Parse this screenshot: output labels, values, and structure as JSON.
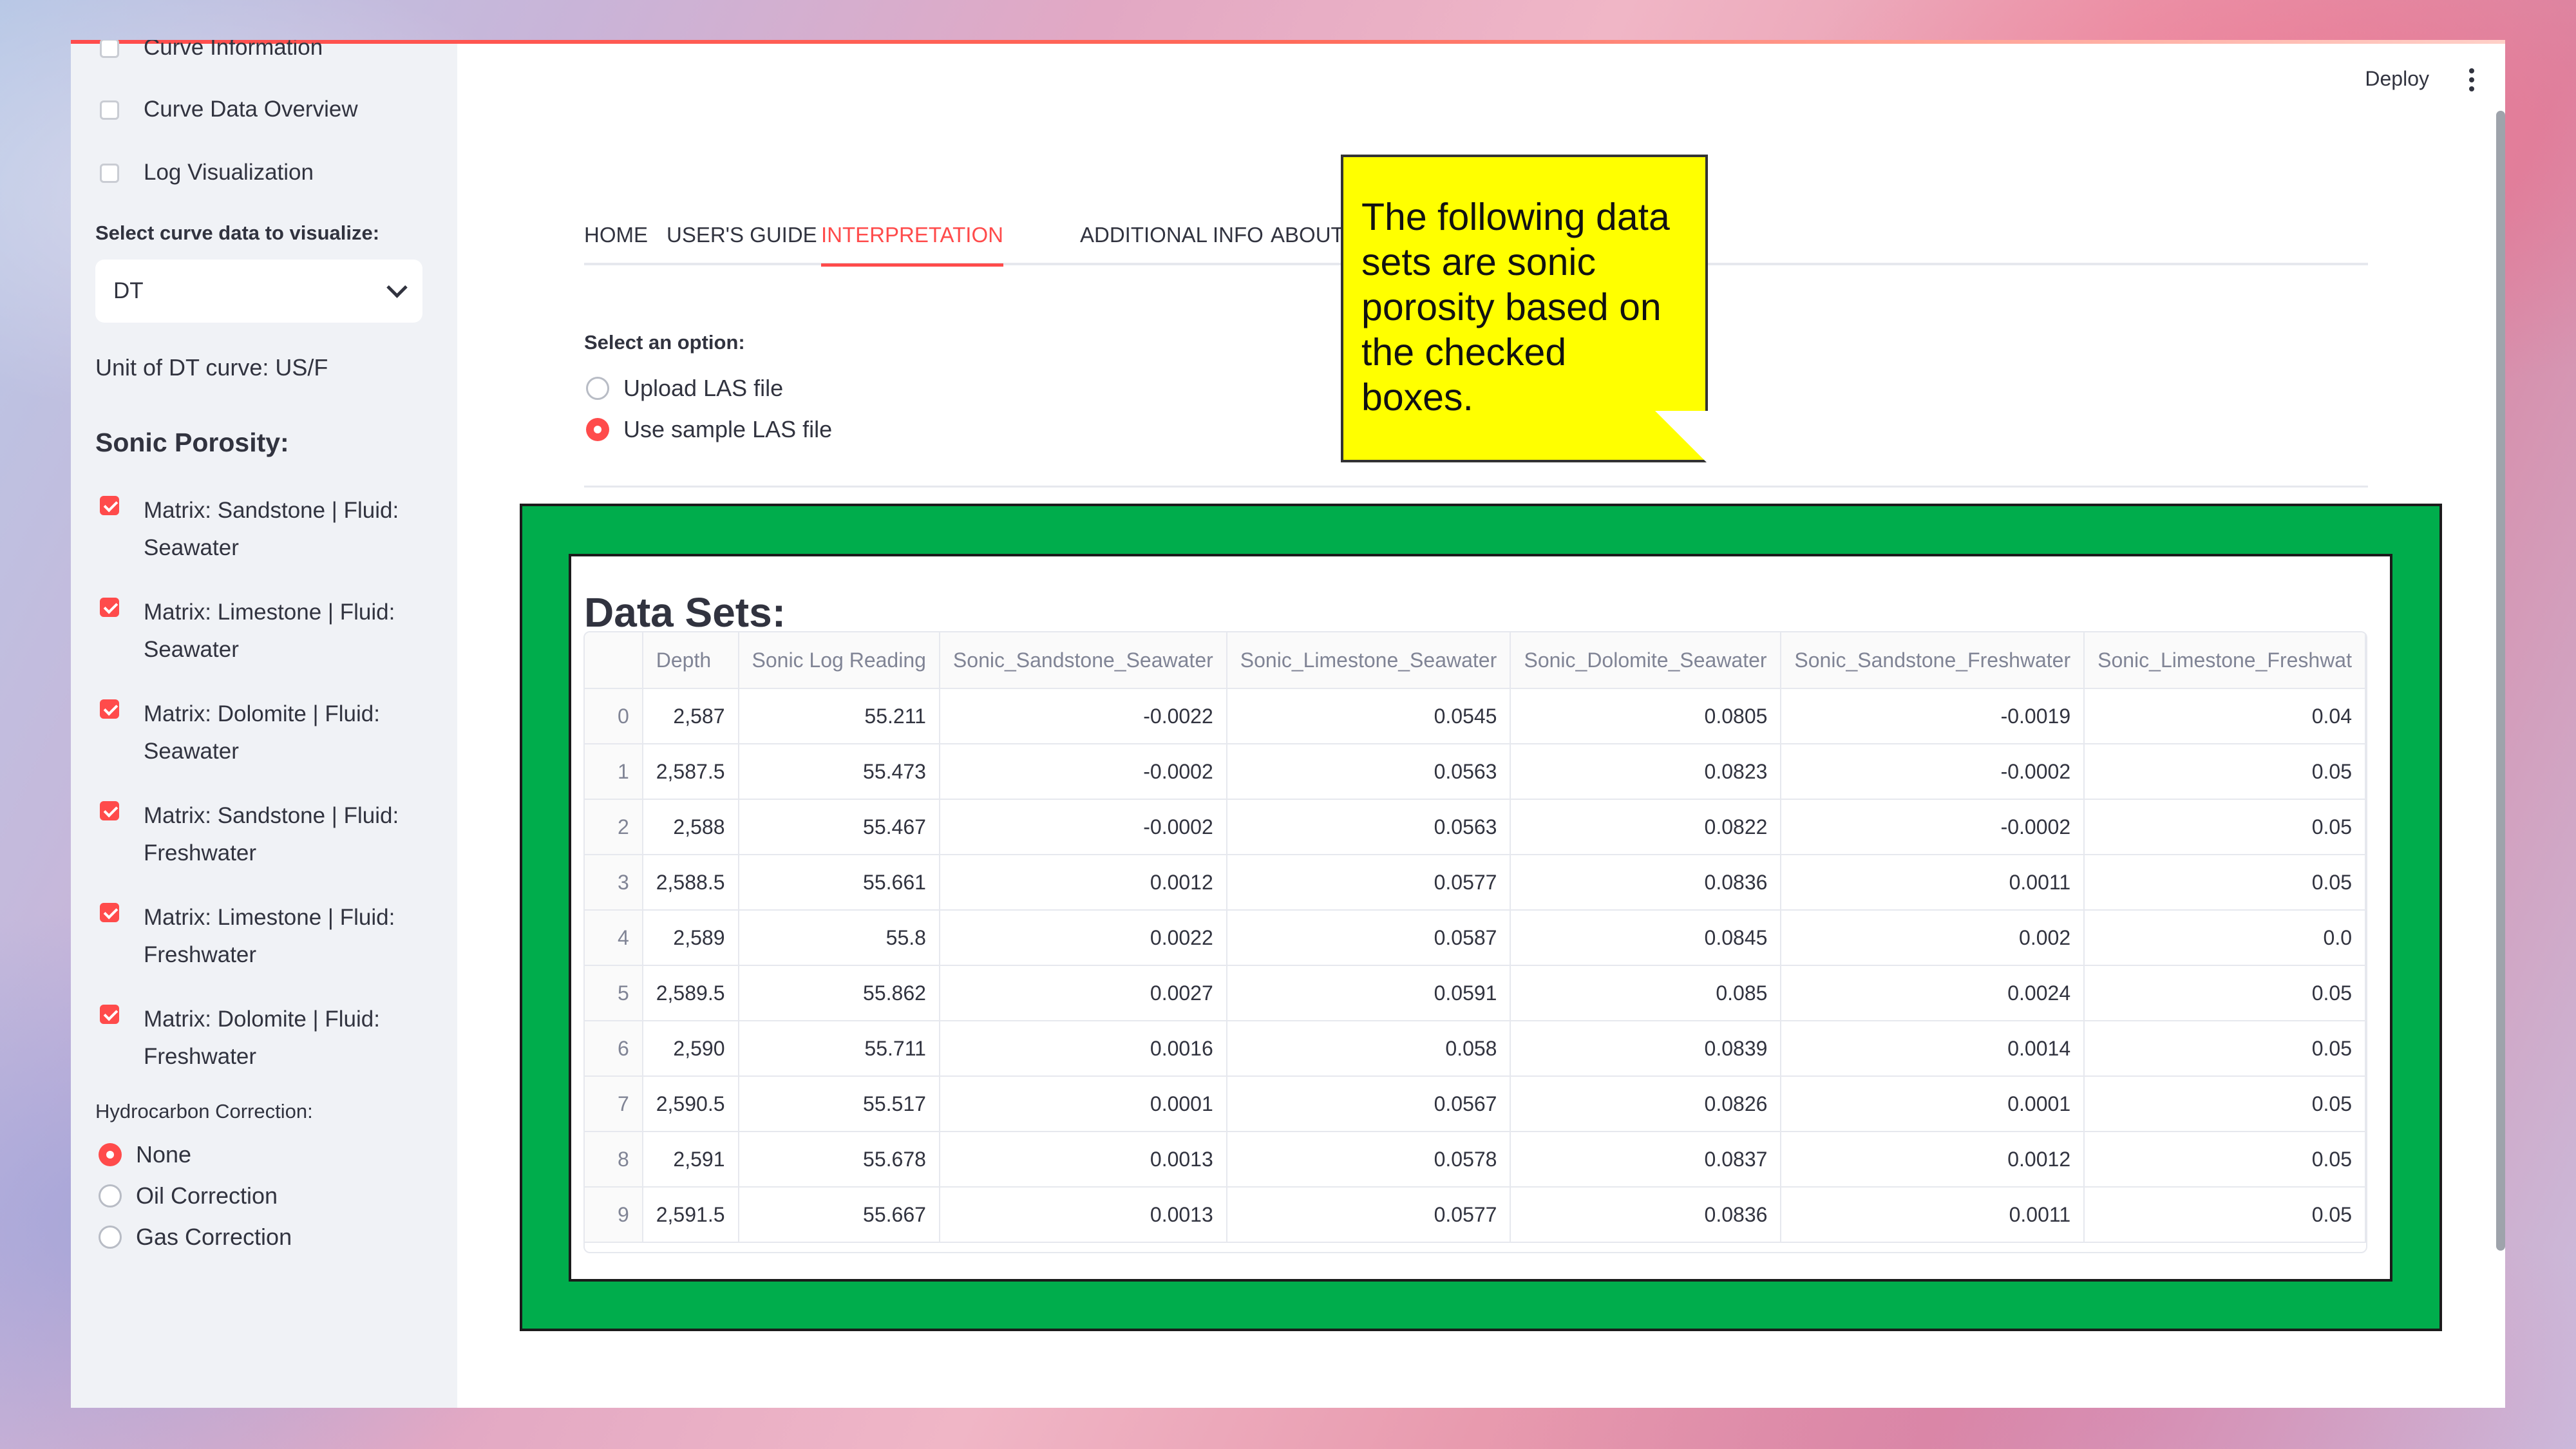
{
  "header": {
    "deploy_label": "Deploy"
  },
  "sidebar": {
    "checkboxes": [
      {
        "label": "Curve Information",
        "checked": false
      },
      {
        "label": "Curve Data Overview",
        "checked": false
      },
      {
        "label": "Log Visualization",
        "checked": false
      }
    ],
    "select_label": "Select curve data to visualize:",
    "select_value": "DT",
    "unit_text": "Unit of DT curve: US/F",
    "porosity_heading": "Sonic Porosity:",
    "porosity_options": [
      {
        "label": "Matrix: Sandstone | Fluid: Seawater",
        "checked": true
      },
      {
        "label": "Matrix: Limestone | Fluid: Seawater",
        "checked": true
      },
      {
        "label": "Matrix: Dolomite | Fluid: Seawater",
        "checked": true
      },
      {
        "label": "Matrix: Sandstone | Fluid: Freshwater",
        "checked": true
      },
      {
        "label": "Matrix: Limestone | Fluid: Freshwater",
        "checked": true
      },
      {
        "label": "Matrix: Dolomite | Fluid: Freshwater",
        "checked": true
      }
    ],
    "hc_label": "Hydrocarbon Correction:",
    "hc_options": [
      {
        "label": "None",
        "selected": true
      },
      {
        "label": "Oil Correction",
        "selected": false
      },
      {
        "label": "Gas Correction",
        "selected": false
      }
    ]
  },
  "tabs": [
    {
      "label": "HOME",
      "active": false
    },
    {
      "label": "USER'S GUIDE",
      "active": false
    },
    {
      "label": "INTERPRETATION",
      "active": true
    },
    {
      "label": "ADDITIONAL INFO",
      "active": false
    },
    {
      "label": "ABOUT US",
      "active": false
    }
  ],
  "main": {
    "option_label": "Select an option:",
    "options": [
      {
        "label": "Upload LAS file",
        "selected": false
      },
      {
        "label": "Use sample LAS file",
        "selected": true
      }
    ],
    "note_text": "The following data sets are sonic porosity based on the checked boxes.",
    "datasets_title": "Data Sets:"
  },
  "table": {
    "columns": [
      "",
      "Depth",
      "Sonic Log Reading",
      "Sonic_Sandstone_Seawater",
      "Sonic_Limestone_Seawater",
      "Sonic_Dolomite_Seawater",
      "Sonic_Sandstone_Freshwater",
      "Sonic_Limestone_Freshwat"
    ],
    "rows": [
      [
        "0",
        "2,587",
        "55.211",
        "-0.0022",
        "0.0545",
        "0.0805",
        "-0.0019",
        "0.04"
      ],
      [
        "1",
        "2,587.5",
        "55.473",
        "-0.0002",
        "0.0563",
        "0.0823",
        "-0.0002",
        "0.05"
      ],
      [
        "2",
        "2,588",
        "55.467",
        "-0.0002",
        "0.0563",
        "0.0822",
        "-0.0002",
        "0.05"
      ],
      [
        "3",
        "2,588.5",
        "55.661",
        "0.0012",
        "0.0577",
        "0.0836",
        "0.0011",
        "0.05"
      ],
      [
        "4",
        "2,589",
        "55.8",
        "0.0022",
        "0.0587",
        "0.0845",
        "0.002",
        "0.0"
      ],
      [
        "5",
        "2,589.5",
        "55.862",
        "0.0027",
        "0.0591",
        "0.085",
        "0.0024",
        "0.05"
      ],
      [
        "6",
        "2,590",
        "55.711",
        "0.0016",
        "0.058",
        "0.0839",
        "0.0014",
        "0.05"
      ],
      [
        "7",
        "2,590.5",
        "55.517",
        "0.0001",
        "0.0567",
        "0.0826",
        "0.0001",
        "0.05"
      ],
      [
        "8",
        "2,591",
        "55.678",
        "0.0013",
        "0.0578",
        "0.0837",
        "0.0012",
        "0.05"
      ],
      [
        "9",
        "2,591.5",
        "55.667",
        "0.0013",
        "0.0577",
        "0.0836",
        "0.0011",
        "0.05"
      ]
    ]
  },
  "colors": {
    "accent": "#ff4b4b",
    "note_bg": "#ffff00",
    "frame_green": "#00ad4c"
  }
}
